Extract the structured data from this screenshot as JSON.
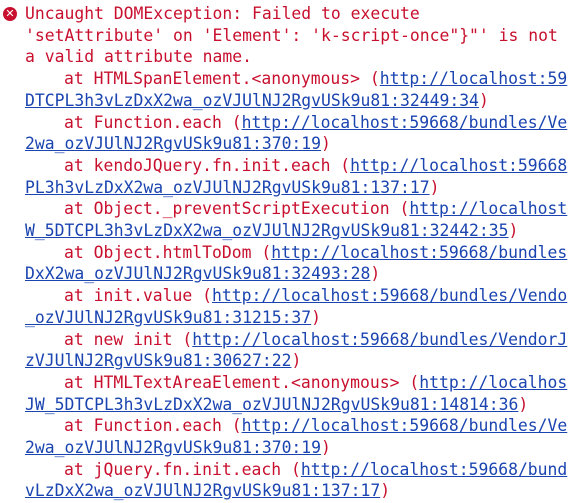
{
  "error": {
    "icon": "error-circle-icon",
    "message_lines": [
      "Uncaught DOMException: Failed to execute",
      "'setAttribute' on 'Element': 'k-script-once\"}\"' is not",
      "a valid attribute name."
    ]
  },
  "frames": [
    {
      "prefix": "at HTMLSpanElement.<anonymous> (",
      "url_head": "http://localhost:59",
      "url_tail": "DTCPL3h3vLzDxX2wa_ozVJUlNJ2RgvUSk9u81:32449:34",
      "suffix": ")"
    },
    {
      "prefix": "at Function.each (",
      "url_head": "http://localhost:59668/bundles/Ve",
      "url_tail": "2wa_ozVJUlNJ2RgvUSk9u81:370:19",
      "suffix": ")"
    },
    {
      "prefix": "at kendoJQuery.fn.init.each (",
      "url_head": "http://localhost:59668",
      "url_tail": "PL3h3vLzDxX2wa_ozVJUlNJ2RgvUSk9u81:137:17",
      "suffix": ")"
    },
    {
      "prefix": "at Object._preventScriptExecution (",
      "url_head": "http://localhost",
      "url_tail": "W_5DTCPL3h3vLzDxX2wa_ozVJUlNJ2RgvUSk9u81:32442:35",
      "suffix": ")"
    },
    {
      "prefix": "at Object.htmlToDom (",
      "url_head": "http://localhost:59668/bundles",
      "url_tail": "DxX2wa_ozVJUlNJ2RgvUSk9u81:32493:28",
      "suffix": ")"
    },
    {
      "prefix": "at init.value (",
      "url_head": "http://localhost:59668/bundles/Vendo",
      "url_tail": "_ozVJUlNJ2RgvUSk9u81:31215:37",
      "suffix": ")"
    },
    {
      "prefix": "at new init (",
      "url_head": "http://localhost:59668/bundles/VendorJ",
      "url_tail": "zVJUlNJ2RgvUSk9u81:30627:22",
      "suffix": ")"
    },
    {
      "prefix": "at HTMLTextAreaElement.<anonymous> (",
      "url_head": "http://localhos",
      "url_tail": "JW_5DTCPL3h3vLzDxX2wa_ozVJUlNJ2RgvUSk9u81:14814:36",
      "suffix": ")"
    },
    {
      "prefix": "at Function.each (",
      "url_head": "http://localhost:59668/bundles/Ve",
      "url_tail": "2wa_ozVJUlNJ2RgvUSk9u81:370:19",
      "suffix": ")"
    },
    {
      "prefix": "at jQuery.fn.init.each (",
      "url_head": "http://localhost:59668/bund",
      "url_tail": "vLzDxX2wa_ozVJUlNJ2RgvUSk9u81:137:17",
      "suffix": ")"
    }
  ],
  "colors": {
    "error_text": "#c8102e",
    "link": "#1a44b0",
    "background": "#ffffff"
  }
}
